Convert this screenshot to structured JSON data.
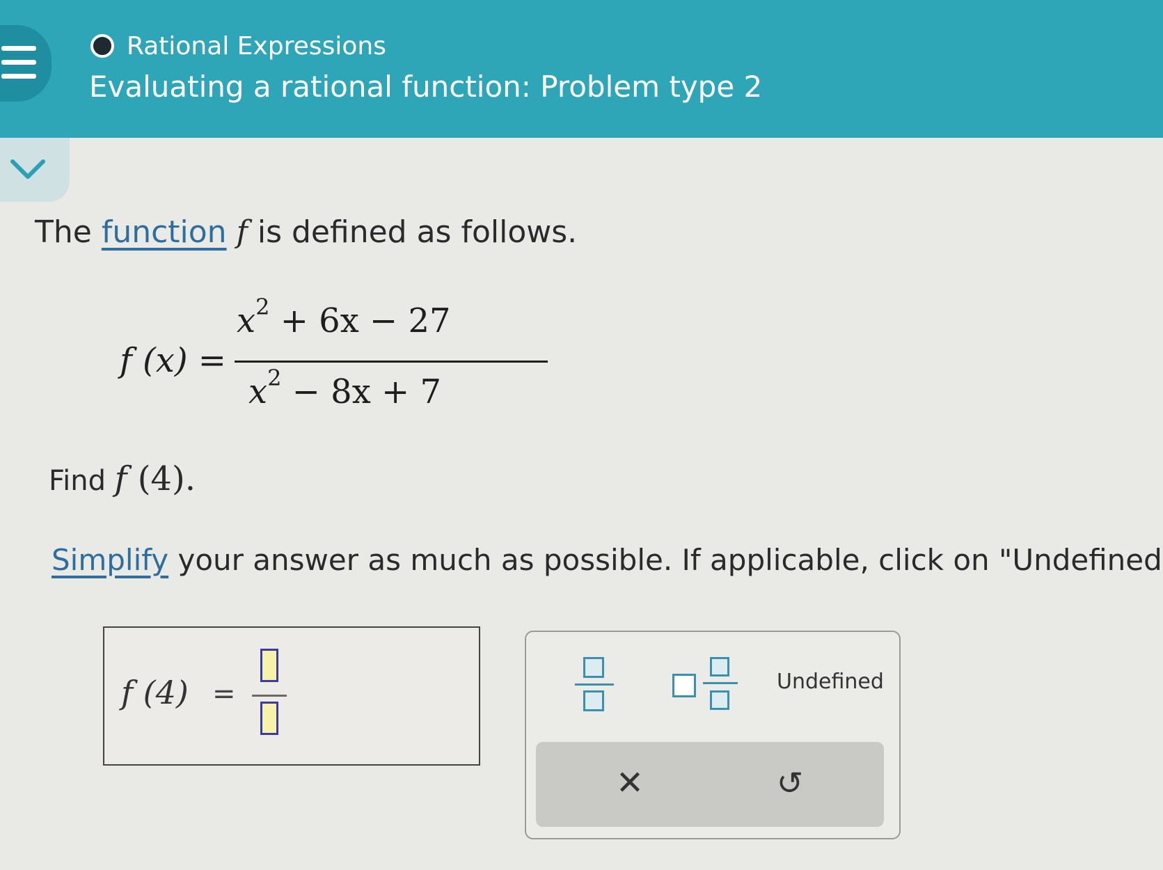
{
  "header": {
    "topic": "Rational Expressions",
    "title": "Evaluating a rational function: Problem type 2"
  },
  "problem": {
    "intro_prefix": "The ",
    "intro_link": "function",
    "intro_var": "f",
    "intro_suffix": " is defined as follows.",
    "formula": {
      "lhs": "f (x) =",
      "numerator": "x² + 6x − 27",
      "numerator_parts": {
        "x": "x",
        "exp": "2",
        "rest": " + 6x − 27"
      },
      "denominator_parts": {
        "x": "x",
        "exp": "2",
        "rest": " − 8x + 7"
      }
    },
    "find_label": "Find ",
    "find_var": "f",
    "find_arg": " (4).",
    "instruction_link": "Simplify",
    "instruction_text": " your answer as much as possible. If applicable, click on \"Undefined"
  },
  "answer": {
    "lhs": "f (4)",
    "equals": "="
  },
  "keypad": {
    "undefined_label": "Undefined",
    "clear_symbol": "✕",
    "undo_symbol": "↺"
  },
  "colors": {
    "header": "#2ea6b8",
    "link": "#2e6e9e",
    "slot_fill": "#f6f2a8",
    "slot_border": "#3a3aa0",
    "key_border": "#3b8fb0"
  }
}
